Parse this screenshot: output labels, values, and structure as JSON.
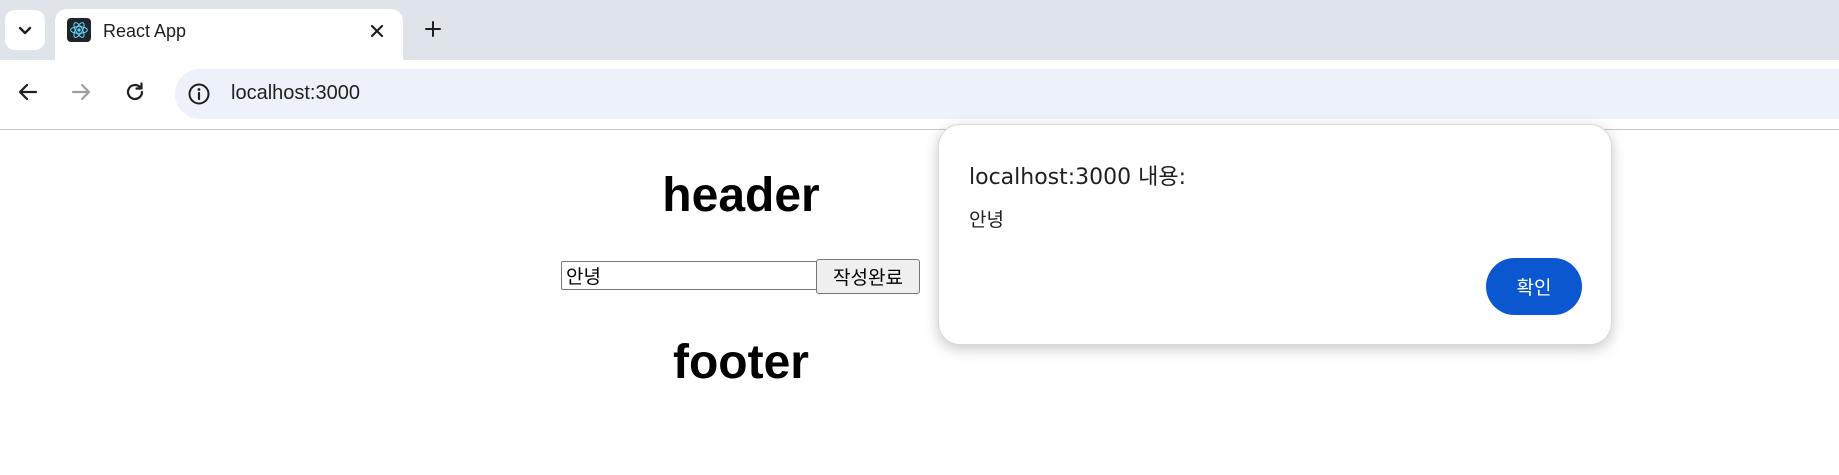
{
  "browser": {
    "tab": {
      "title": "React App",
      "favicon": "react-logo-icon"
    },
    "icons": {
      "tab_search": "chevron-down-icon",
      "tab_close": "close-icon",
      "new_tab": "plus-icon",
      "back": "arrow-left-icon",
      "forward": "arrow-right-icon",
      "reload": "reload-icon",
      "site_info": "info-icon"
    },
    "address": "localhost:3000"
  },
  "page": {
    "header": "header",
    "input_value": "안녕",
    "submit_label": "작성완료",
    "footer": "footer"
  },
  "dialog": {
    "title": "localhost:3000 내용:",
    "message": "안녕",
    "ok_label": "확인"
  },
  "colors": {
    "tabstrip_bg": "#dfe3ea",
    "omnibox_bg": "#edf2fa",
    "accent": "#0b57d0",
    "react_logo": "#61dafb"
  }
}
